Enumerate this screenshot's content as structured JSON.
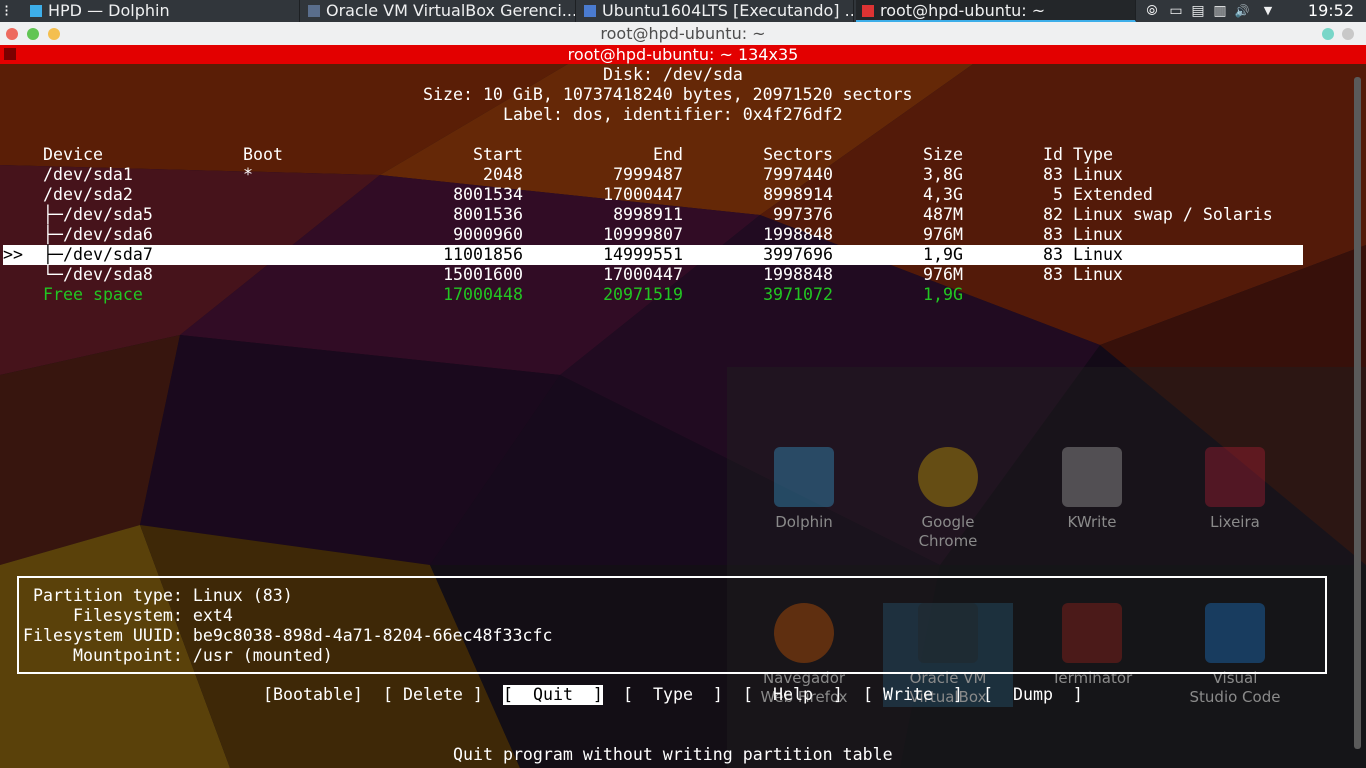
{
  "panel": {
    "launcher_glyph": "⁝",
    "tasks": [
      {
        "label": "HPD — Dolphin",
        "icon": "folder-icon"
      },
      {
        "label": "Oracle VM VirtualBox Gerenci...",
        "icon": "virtualbox-icon"
      },
      {
        "label": "Ubuntu1604LTS [Executando] ...",
        "icon": "virtualbox-vm-icon"
      },
      {
        "label": "root@hpd-ubuntu: ~",
        "icon": "terminal-icon",
        "active": true
      }
    ],
    "tray": [
      "network-icon",
      "display-icon",
      "clipboard-icon",
      "notes-icon",
      "volume-icon",
      "expand-tray-icon"
    ],
    "tray_glyphs": [
      "⦾",
      "▭",
      "▤",
      "▥",
      "🔊",
      "▼"
    ],
    "clock": "19:52"
  },
  "window": {
    "title": "root@hpd-ubuntu: ~",
    "tab_title": "root@hpd-ubuntu: ~ 134x35"
  },
  "fdisk": {
    "disk_line": "Disk: /dev/sda",
    "size_line": "Size: 10 GiB, 10737418240 bytes, 20971520 sectors",
    "label_line": "Label: dos, identifier: 0x4f276df2",
    "headers": {
      "device": "Device",
      "boot": "Boot",
      "start": "Start",
      "end": "End",
      "sectors": "Sectors",
      "size": "Size",
      "idtype": "Id Type"
    },
    "rows": [
      {
        "device": "/dev/sda1",
        "boot": "*",
        "start": "2048",
        "end": "7999487",
        "sectors": "7997440",
        "size": "3,8G",
        "idtype": "83 Linux",
        "marker": ""
      },
      {
        "device": "/dev/sda2",
        "boot": "",
        "start": "8001534",
        "end": "17000447",
        "sectors": "8998914",
        "size": "4,3G",
        "idtype": " 5 Extended",
        "marker": ""
      },
      {
        "device": "├─/dev/sda5",
        "boot": "",
        "start": "8001536",
        "end": "8998911",
        "sectors": "997376",
        "size": "487M",
        "idtype": "82 Linux swap / Solaris",
        "marker": ""
      },
      {
        "device": "├─/dev/sda6",
        "boot": "",
        "start": "9000960",
        "end": "10999807",
        "sectors": "1998848",
        "size": "976M",
        "idtype": "83 Linux",
        "marker": ""
      },
      {
        "device": "├─/dev/sda7",
        "boot": "",
        "start": "11001856",
        "end": "14999551",
        "sectors": "3997696",
        "size": "1,9G",
        "idtype": "83 Linux",
        "marker": ">>",
        "selected": true
      },
      {
        "device": "└─/dev/sda8",
        "boot": "",
        "start": "15001600",
        "end": "17000447",
        "sectors": "1998848",
        "size": "976M",
        "idtype": "83 Linux",
        "marker": ""
      }
    ],
    "free": {
      "device": "Free space",
      "start": "17000448",
      "end": "20971519",
      "sectors": "3971072",
      "size": "1,9G"
    },
    "info": {
      "partition_type": "Partition type: Linux (83)",
      "filesystem": "    Filesystem: ext4",
      "uuid": "Filesystem UUID: be9c8038-898d-4a71-8204-66ec48f33cfc",
      "mountpoint": "    Mountpoint: /usr (mounted)"
    },
    "menu": [
      {
        "label": "[Bootable]",
        "name": "bootable-menu"
      },
      {
        "label": "[ Delete ]",
        "name": "delete-menu"
      },
      {
        "label": "[  Quit  ]",
        "name": "quit-menu",
        "selected": true
      },
      {
        "label": "[  Type  ]",
        "name": "type-menu"
      },
      {
        "label": "[  Help  ]",
        "name": "help-menu"
      },
      {
        "label": "[ Write  ]",
        "name": "write-menu"
      },
      {
        "label": "[  Dump  ]",
        "name": "dump-menu"
      }
    ],
    "status": "Quit program without writing partition table"
  },
  "launcher_apps": [
    {
      "label": "Dolphin",
      "icon": "dolphin-icon"
    },
    {
      "label": "Google\nChrome",
      "icon": "chrome-icon"
    },
    {
      "label": "KWrite",
      "icon": "kwrite-icon"
    },
    {
      "label": "Lixeira",
      "icon": "trash-icon"
    },
    {
      "label": "Navegador\nWeb Firefox",
      "icon": "firefox-icon"
    },
    {
      "label": "Oracle VM\nVirtualBox",
      "icon": "virtualbox-icon"
    },
    {
      "label": "Terminator",
      "icon": "terminator-icon"
    },
    {
      "label": "Visual\nStudio Code",
      "icon": "vscode-icon"
    }
  ],
  "colors": {
    "tab_bar": "#e30000",
    "free_space": "#22c522",
    "panel_bg": "#31363b",
    "accent": "#3daee9"
  }
}
